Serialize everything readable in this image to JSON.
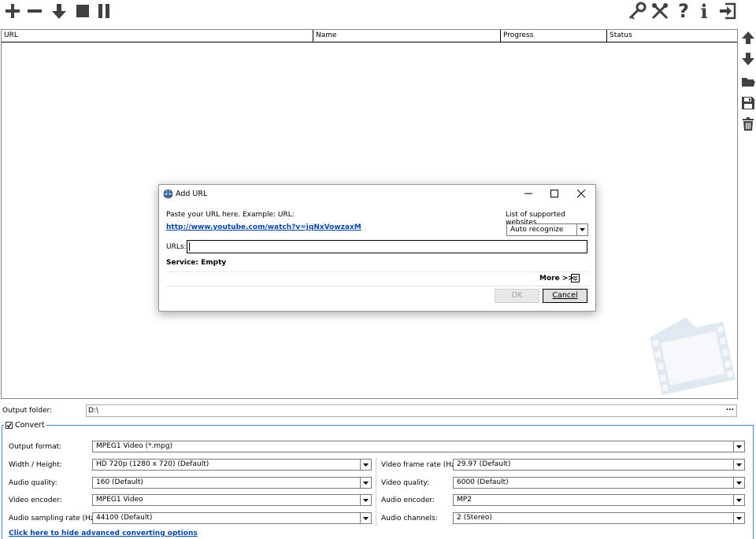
{
  "toolbar": {
    "left_icons": [
      "plus-icon",
      "minus-icon",
      "download-arrow-icon",
      "stop-icon",
      "pause-icon"
    ],
    "right_icons": [
      "key-icon",
      "tools-icon",
      "help-icon",
      "info-icon",
      "exit-icon"
    ]
  },
  "list": {
    "columns": [
      "URL",
      "Name",
      "Progress",
      "Status"
    ]
  },
  "side_buttons": [
    "move-up-icon",
    "move-down-icon",
    "folder-icon",
    "save-icon",
    "trash-icon"
  ],
  "dialog": {
    "title": "Add URL",
    "hint": "Paste your URL here. Example: URL:",
    "example_url": "http://www.youtube.com/watch?v=jqNxVowzaxM",
    "supported_label": "List of supported websites",
    "service_select": "Auto recognize",
    "urls_label": "URLs:",
    "urls_value": "",
    "service_status": "Service: Empty",
    "more_label": "More >>",
    "ok_label": "OK",
    "cancel_label": "Cancel"
  },
  "output": {
    "folder_label": "Output folder:",
    "folder_value": "D:\\",
    "browse_label": "..."
  },
  "convert": {
    "group_label": "Convert",
    "checked": true,
    "output_format_label": "Output format:",
    "output_format_value": "MPEG1 Video (*.mpg)",
    "width_height_label": "Width / Height:",
    "width_height_value": "HD 720p (1280 x 720) (Default)",
    "audio_quality_label": "Audio quality:",
    "audio_quality_value": "160 (Default)",
    "video_encoder_label": "Video encoder:",
    "video_encoder_value": "MPEG1 Video",
    "audio_sampling_label": "Audio sampling rate (Hz):",
    "audio_sampling_value": "44100 (Default)",
    "video_frame_rate_label": "Video frame rate (Hz):",
    "video_frame_rate_value": "29.97 (Default)",
    "video_quality_label": "Video quality:",
    "video_quality_value": "6000 (Default)",
    "audio_encoder_label": "Audio encoder:",
    "audio_encoder_value": "MP2",
    "audio_channels_label": "Audio channels:",
    "audio_channels_value": "2 (Stereo)",
    "hide_link": "Click here to hide advanced converting options"
  },
  "colors": {
    "accent_border": "#3c8ed8",
    "link": "#0645ad",
    "icon": "#404040"
  }
}
